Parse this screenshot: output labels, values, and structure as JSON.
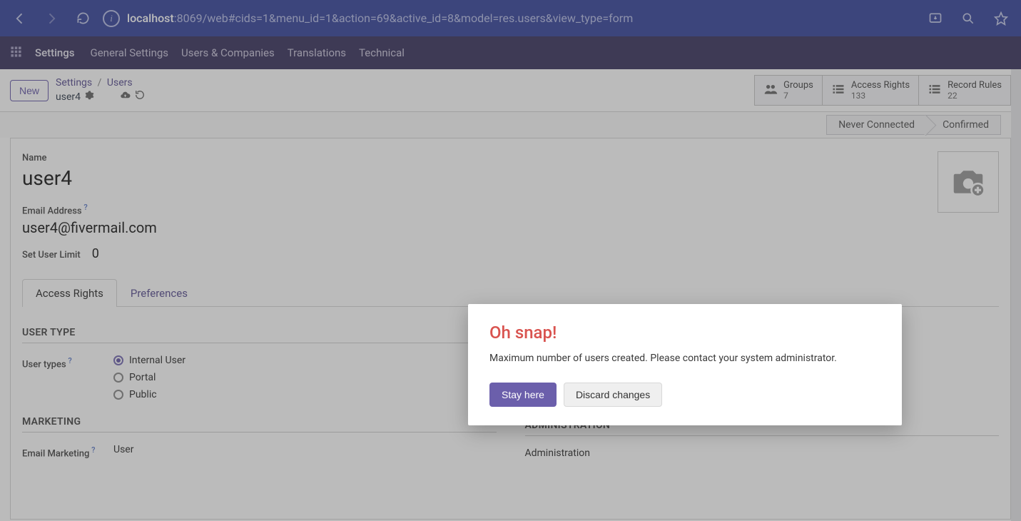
{
  "browser": {
    "url_host": "localhost",
    "url_rest": ":8069/web#cids=1&menu_id=1&action=69&active_id=8&model=res.users&view_type=form"
  },
  "app_menu": {
    "title": "Settings",
    "items": [
      "General Settings",
      "Users & Companies",
      "Translations",
      "Technical"
    ]
  },
  "control_panel": {
    "new_label": "New",
    "breadcrumb": {
      "root": "Settings",
      "mid": "Users",
      "name": "user4"
    },
    "stats": [
      {
        "icon": "people-icon",
        "label": "Groups",
        "count": "7"
      },
      {
        "icon": "list-icon",
        "label": "Access Rights",
        "count": "133"
      },
      {
        "icon": "list-icon",
        "label": "Record Rules",
        "count": "22"
      }
    ]
  },
  "status": {
    "steps": [
      "Never Connected",
      "Confirmed"
    ]
  },
  "form": {
    "name_label": "Name",
    "name_value": "user4",
    "email_label": "Email Address",
    "email_value": "user4@fivermail.com",
    "limit_label": "Set User Limit",
    "limit_value": "0",
    "tabs": [
      "Access Rights",
      "Preferences"
    ],
    "group_user_type": "USER TYPE",
    "user_types_label": "User types",
    "user_types_options": [
      "Internal User",
      "Portal",
      "Public"
    ],
    "group_marketing": "MARKETING",
    "email_marketing_label": "Email Marketing",
    "email_marketing_value": "User",
    "group_admin": "ADMINISTRATION",
    "admin_value": "Administration"
  },
  "modal": {
    "title": "Oh snap!",
    "body": "Maximum number of users created. Please contact your system administrator.",
    "stay": "Stay here",
    "discard": "Discard changes"
  }
}
